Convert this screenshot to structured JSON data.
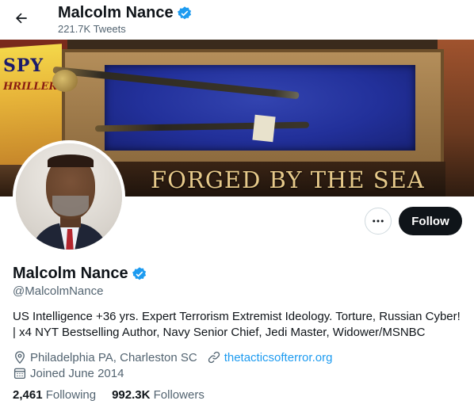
{
  "header": {
    "name": "Malcolm Nance",
    "tweet_count": "221.7K Tweets"
  },
  "banner": {
    "poster_line1": "SPY",
    "poster_line2": "HRILLERS",
    "plaque_text": "FORGED BY THE SEA"
  },
  "actions": {
    "follow_label": "Follow"
  },
  "profile": {
    "display_name": "Malcolm Nance",
    "handle": "@MalcolmNance",
    "bio_line1": "US Intelligence +36 yrs. Expert Terrorism Extremist Ideology. Torture, Russian Cyber!",
    "bio_line2": "| x4 NYT Bestselling Author, Navy Senior Chief, Jedi Master, Widower/MSNBC",
    "location": "Philadelphia PA, Charleston SC",
    "website": "thetacticsofterror.org",
    "joined": "Joined June 2014"
  },
  "stats": {
    "following_count": "2,461",
    "following_label": "Following",
    "followers_count": "992.3K",
    "followers_label": "Followers"
  },
  "colors": {
    "verified": "#1d9bf0",
    "link": "#1d9bf0",
    "follow_bg": "#0f1419",
    "secondary_text": "#536471"
  },
  "icons": [
    "back-arrow-icon",
    "verified-badge-icon",
    "more-options-icon",
    "location-pin-icon",
    "link-icon",
    "calendar-icon"
  ]
}
